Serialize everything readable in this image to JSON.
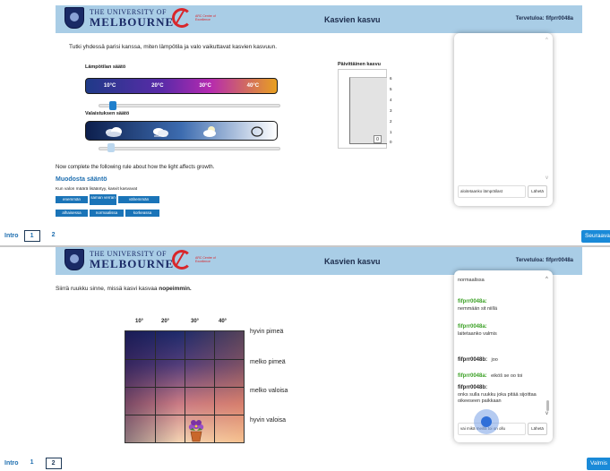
{
  "header": {
    "uni_line1": "THE UNIVERSITY OF",
    "uni_line2": "MELBOURNE",
    "arc_text": "ARC Centre of Excellence",
    "title": "Kasvien kasvu",
    "welcome": "Tervetuloa: fifprr0048a"
  },
  "panel1": {
    "instruction": "Tutki yhdessä parisi kanssa, miten lämpötila ja valo vaikuttavat kasvien kasvuun.",
    "temp_label": "Lämpötilan säätö",
    "temp_steps": [
      "10°C",
      "20°C",
      "30°C",
      "40°C"
    ],
    "light_label": "Valaistuksen säätö",
    "light_icons": [
      "very-cloudy-icon",
      "cloudy-icon",
      "partly-sunny-icon",
      "sun-icon"
    ],
    "growth_label": "Päivittäinen kasvu",
    "growth_ticks": [
      "6",
      "5",
      "4",
      "3",
      "2",
      "1",
      "0"
    ],
    "growth_value": "0",
    "rule_prompt": "Now complete the following rule about how the light affects growth.",
    "rule_title": "Muodosta sääntö",
    "rule_sentence": "Kun valon määrä lisääntyy, kasvit kasvavat",
    "rule_options_row1": [
      "enemmän",
      "saman verran",
      "vähemmän"
    ],
    "rule_options_row2": [
      "alhaisessa",
      "normaalissa",
      "korkeassa"
    ],
    "chat_input": "aloitetaanko lämpötilast",
    "chat_send": "Lähetä",
    "pager_label": "Intro",
    "pages": [
      "1",
      "2"
    ],
    "active_page": "1",
    "next_button": "Seuraava"
  },
  "panel2": {
    "instruction_prefix": "Siirrä ruukku sinne, missä kasvi kasvaa ",
    "instruction_bold": "nopeimmin.",
    "col_labels": [
      "10°",
      "20°",
      "30°",
      "40°"
    ],
    "row_labels": [
      "hyvin pimeä",
      "melko pimeä",
      "melko valoisa",
      "hyvin valoisa"
    ],
    "chat_messages": [
      {
        "who": "",
        "text": "normaalissa",
        "kind": "other"
      },
      {
        "who": "fifprr0048a:",
        "text": "nemmään sit niillä",
        "kind": "me"
      },
      {
        "who": "fifprr0048a:",
        "text": "laitetaanko valmis",
        "kind": "me"
      },
      {
        "who": "fifprr0048b:",
        "text": "joo",
        "kind": "other"
      },
      {
        "who": "fifprr0048a:",
        "text": "eiköš se oo toi",
        "kind": "me"
      },
      {
        "who": "fifprr0048b:",
        "text": "onks sulla ruukku joka pitää sijoittaa oikeeseen paikkaan",
        "kind": "other"
      }
    ],
    "chat_input": "vai mikä meillä toi on ollu",
    "chat_send": "Lähetä",
    "pager_label": "Intro",
    "pages": [
      "1",
      "2"
    ],
    "active_page": "2",
    "next_button": "Valmis"
  },
  "colors": {
    "header_bg": "#a9cde6",
    "accent_blue": "#1a8ad8",
    "me_name": "#3aa024",
    "rule_chip": "#1a74b8"
  }
}
